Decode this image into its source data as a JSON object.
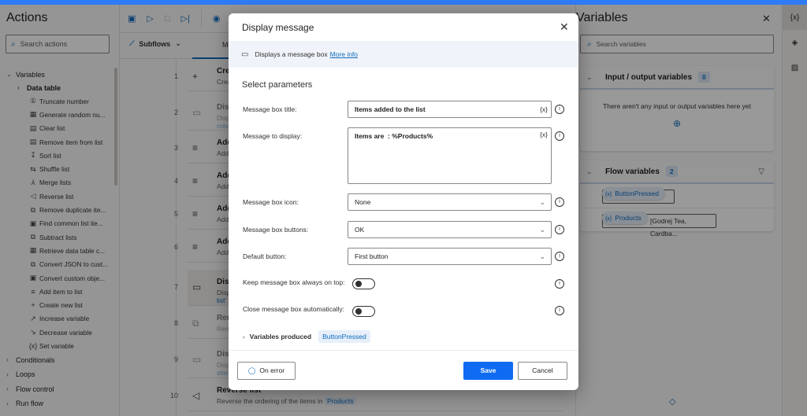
{
  "actions_panel": {
    "title": "Actions",
    "search_placeholder": "Search actions",
    "tree": {
      "variables": {
        "label": "Variables"
      },
      "data_table": {
        "label": "Data table"
      },
      "items": [
        {
          "label": "Truncate number",
          "icon": "①"
        },
        {
          "label": "Generate random nu...",
          "icon": "▦"
        },
        {
          "label": "Clear list",
          "icon": "▤"
        },
        {
          "label": "Remove item from list",
          "icon": "▤"
        },
        {
          "label": "Sort list",
          "icon": "↧"
        },
        {
          "label": "Shuffle list",
          "icon": "⇆"
        },
        {
          "label": "Merge lists",
          "icon": "⅄"
        },
        {
          "label": "Reverse list",
          "icon": "◁"
        },
        {
          "label": "Remove duplicate ite...",
          "icon": "⧉"
        },
        {
          "label": "Find common list ite...",
          "icon": "▣"
        },
        {
          "label": "Subtract lists",
          "icon": "⧉"
        },
        {
          "label": "Retrieve data table c...",
          "icon": "▦"
        },
        {
          "label": "Convert JSON to cust...",
          "icon": "⧉"
        },
        {
          "label": "Convert custom obje...",
          "icon": "▣"
        },
        {
          "label": "Add item to list",
          "icon": "≡"
        },
        {
          "label": "Create new list",
          "icon": "+"
        },
        {
          "label": "Increase variable",
          "icon": "↗"
        },
        {
          "label": "Decrease variable",
          "icon": "↘"
        },
        {
          "label": "Set variable",
          "icon": "{x}"
        }
      ],
      "categories": [
        {
          "label": "Conditionals"
        },
        {
          "label": "Loops"
        },
        {
          "label": "Flow control"
        },
        {
          "label": "Run flow"
        }
      ]
    }
  },
  "toolbar": {
    "subflows_label": "Subflows",
    "main_tab_label": "Main"
  },
  "flow_steps": [
    {
      "line": "1",
      "icon": "+",
      "title": "Create new list",
      "desc": "Create a new empty list"
    },
    {
      "line": "2",
      "icon": "▭",
      "title": "Display message",
      "desc": "Display the message",
      "desc2": "created",
      "disabled": true
    },
    {
      "line": "3",
      "icon": "≡",
      "title": "Add item to list",
      "desc": "Add item"
    },
    {
      "line": "4",
      "icon": "≡",
      "title": "Add item to list",
      "desc": "Add item"
    },
    {
      "line": "5",
      "icon": "≡",
      "title": "Add item to list",
      "desc": "Add item"
    },
    {
      "line": "6",
      "icon": "≡",
      "title": "Add item to list",
      "desc": "Add item"
    },
    {
      "line": "7",
      "icon": "▭",
      "title": "Display message",
      "desc": "Display the message",
      "desc2": "list'",
      "selected": true
    },
    {
      "line": "8",
      "icon": "⧉",
      "title": "Remove duplicate items",
      "desc": "Remove duplicates",
      "disabled": true
    },
    {
      "line": "9",
      "icon": "▭",
      "title": "Display message",
      "desc": "Display the message",
      "desc2": "stored",
      "disabled": true
    },
    {
      "line": "10",
      "icon": "◁",
      "title": "Reverse list",
      "desc": "Reverse the ordering of the items in",
      "token": "Products"
    }
  ],
  "variables_panel": {
    "title": "Variables",
    "search_placeholder": "Search variables",
    "io_section": {
      "label": "Input / output variables",
      "count": "0",
      "empty_text": "There aren't any input or output variables here yet"
    },
    "flow_section": {
      "label": "Flow variables",
      "count": "2",
      "items": [
        {
          "name": "ButtonPressed",
          "value": ""
        },
        {
          "name": "Products",
          "value": "[Godrej Tea, Cardba..."
        }
      ]
    }
  },
  "right_rail": {
    "items": [
      {
        "icon": "{x}",
        "name": "variables"
      },
      {
        "icon": "◈",
        "name": "ui-elements"
      },
      {
        "icon": "▨",
        "name": "images"
      }
    ]
  },
  "dialog": {
    "title": "Display message",
    "info_text": "Displays a message box",
    "info_link": "More info",
    "section_title": "Select parameters",
    "fields": {
      "title": {
        "label": "Message box title:",
        "value": "Items added to the list"
      },
      "message": {
        "label": "Message to display:",
        "value": "Items are  : %Products%"
      },
      "icon": {
        "label": "Message box icon:",
        "value": "None"
      },
      "buttons": {
        "label": "Message box buttons:",
        "value": "OK"
      },
      "default_button": {
        "label": "Default button:",
        "value": "First button"
      },
      "always_on_top": {
        "label": "Keep message box always on top:",
        "value": false
      },
      "close_auto": {
        "label": "Close message box automatically:",
        "value": false
      }
    },
    "variable_token": "{x}",
    "variables_produced_label": "Variables produced",
    "variables_produced": [
      "ButtonPressed"
    ],
    "on_error_label": "On error",
    "save_label": "Save",
    "cancel_label": "Cancel"
  },
  "colors": {
    "accent": "#0f6cbd",
    "save_button": "#0f6cf2",
    "top_bar": "#2f7bf5"
  }
}
